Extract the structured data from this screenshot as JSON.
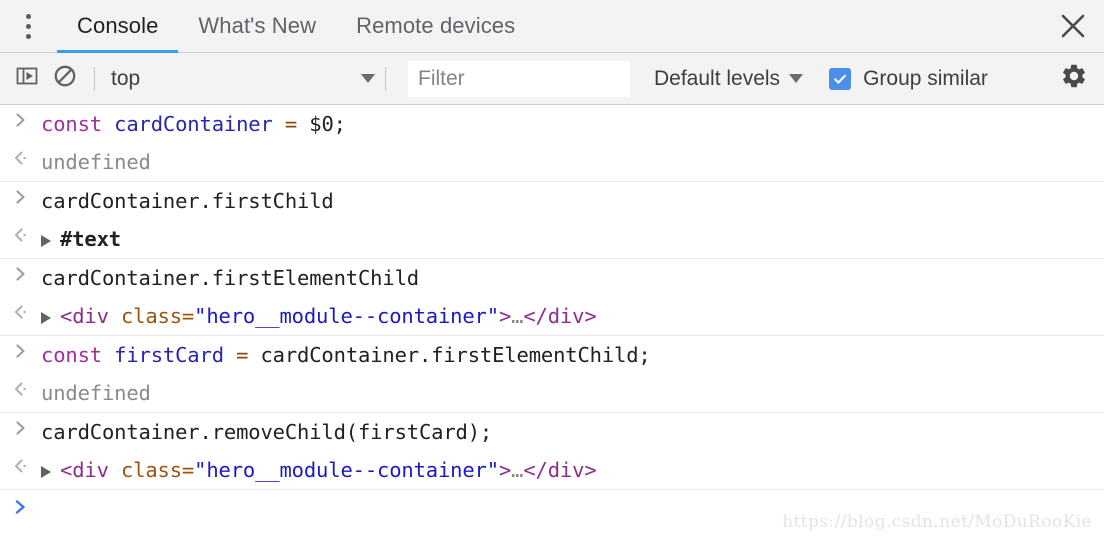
{
  "window": {
    "menu_icon": "three-dots-vertical-icon",
    "close_icon": "close-icon"
  },
  "tabs": [
    {
      "label": "Console",
      "active": true
    },
    {
      "label": "What's New",
      "active": false
    },
    {
      "label": "Remote devices",
      "active": false
    }
  ],
  "toolbar": {
    "sidebar_toggle_icon": "console-sidebar-icon",
    "clear_console_icon": "clear-console-icon",
    "context_value": "top",
    "context_caret_icon": "chevron-down-icon",
    "filter_placeholder": "Filter",
    "filter_value": "",
    "levels_label": "Default levels",
    "levels_caret_icon": "chevron-down-icon",
    "group_similar_label": "Group similar",
    "group_similar_checked": true,
    "settings_icon": "gear-icon"
  },
  "console": {
    "input_marker": "input-chevron-icon",
    "output_marker": "output-chevron-icon",
    "groups": [
      {
        "input": {
          "tokens": [
            {
              "text": "const ",
              "cls": "t-keyword"
            },
            {
              "text": "cardContainer ",
              "cls": "t-var"
            },
            {
              "text": "=",
              "cls": "t-op"
            },
            {
              "text": " $0;",
              "cls": "t-plain"
            }
          ]
        },
        "output": {
          "expandable": false,
          "tokens": [
            {
              "text": "undefined",
              "cls": "t-undef"
            }
          ]
        }
      },
      {
        "input": {
          "tokens": [
            {
              "text": "cardContainer.firstChild",
              "cls": "t-plain"
            }
          ]
        },
        "output": {
          "expandable": true,
          "tokens": [
            {
              "text": "#text",
              "cls": "t-node"
            }
          ]
        }
      },
      {
        "input": {
          "tokens": [
            {
              "text": "cardContainer.firstElementChild",
              "cls": "t-plain"
            }
          ]
        },
        "output": {
          "expandable": true,
          "tokens": [
            {
              "text": "<div",
              "cls": "t-tag"
            },
            {
              "text": " class=",
              "cls": "t-attrname"
            },
            {
              "text": "\"hero__module--container\"",
              "cls": "t-attrval"
            },
            {
              "text": ">",
              "cls": "t-tag"
            },
            {
              "text": "…",
              "cls": "t-ellipsis"
            },
            {
              "text": "</div>",
              "cls": "t-tag"
            }
          ]
        }
      },
      {
        "input": {
          "tokens": [
            {
              "text": "const ",
              "cls": "t-keyword"
            },
            {
              "text": "firstCard ",
              "cls": "t-var"
            },
            {
              "text": "=",
              "cls": "t-op"
            },
            {
              "text": " cardContainer.firstElementChild;",
              "cls": "t-plain"
            }
          ]
        },
        "output": {
          "expandable": false,
          "tokens": [
            {
              "text": "undefined",
              "cls": "t-undef"
            }
          ]
        }
      },
      {
        "input": {
          "tokens": [
            {
              "text": "cardContainer.removeChild(firstCard);",
              "cls": "t-plain"
            }
          ]
        },
        "output": {
          "expandable": true,
          "tokens": [
            {
              "text": "<div",
              "cls": "t-tag"
            },
            {
              "text": " class=",
              "cls": "t-attrname"
            },
            {
              "text": "\"hero__module--container\"",
              "cls": "t-attrval"
            },
            {
              "text": ">",
              "cls": "t-tag"
            },
            {
              "text": "…",
              "cls": "t-ellipsis"
            },
            {
              "text": "</div>",
              "cls": "t-tag"
            }
          ]
        }
      }
    ],
    "prompt_marker": "prompt-chevron-icon",
    "prompt_value": ""
  },
  "watermark": "https://blog.csdn.net/MoDuRooKie"
}
